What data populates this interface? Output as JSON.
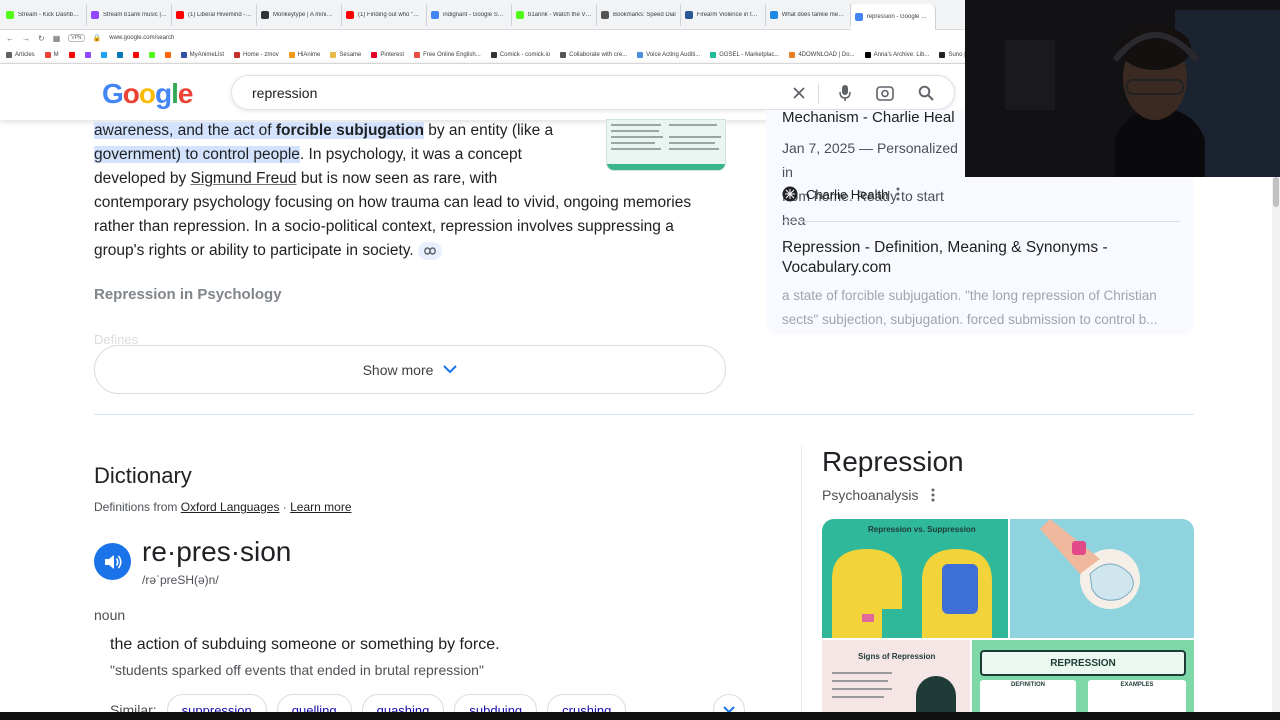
{
  "browser": {
    "tabs": [
      {
        "label": "Stream - Kick Dashboard",
        "color": "#53fc18"
      },
      {
        "label": "Stream b1ank music | Lis",
        "color": "#9146ff"
      },
      {
        "label": "(1) Liberal Hivemind - Yo",
        "color": "#ff0000"
      },
      {
        "label": "Monkeytype | A minimalis",
        "color": "#323437"
      },
      {
        "label": "(1) Finding out who \"own",
        "color": "#ff0000"
      },
      {
        "label": "indignant - Google Search",
        "color": "#4285f4"
      },
      {
        "label": "b1annk - Watch the VOD",
        "color": "#53fc18"
      },
      {
        "label": "Bookmarks: Speed Dial",
        "color": "#555555"
      },
      {
        "label": "Firearm Violence in the U",
        "color": "#2b5797"
      },
      {
        "label": "What does tankie mean -",
        "color": "#1e88e5"
      },
      {
        "label": "repression - Google Searc",
        "color": "#4285f4"
      }
    ],
    "url": "www.google.com/search",
    "vpn_label": "VPN",
    "bookmarks": [
      "Articles",
      "M",
      "",
      "",
      "",
      "",
      "",
      "",
      "",
      "MyAnimeList",
      "Home - zmov",
      "HiAnime",
      "Sesame",
      "Pinterest",
      "Free Online English...",
      "Comick - comick.io",
      "Collaborate with cre...",
      "Voice Acting Auditi...",
      "GGSEL - Marketplac...",
      "4DOWNLOAD | Do...",
      "Anna's Archive: Lib...",
      "Suno | AI Music"
    ]
  },
  "search": {
    "logo": [
      "G",
      "o",
      "o",
      "g",
      "l",
      "e"
    ],
    "query": "repression"
  },
  "snippet": {
    "line1_hl_a": "awareness, and the act of ",
    "line1_hl_b": "forcible subjugation",
    "line1_rest": " by an entity (like a",
    "line2_hl": "government) to control people",
    "line2_rest": ". In psychology, it was a concept",
    "line3_a": "developed by ",
    "line3_link": "Sigmund Freud",
    "line3_b": " but is now seen as rare, with",
    "line4": "contemporary psychology focusing on how trauma can lead to vivid, ongoing memories",
    "line5": "rather than repression. In a socio-political context, repression involves suppressing a",
    "line6": "group's rights or ability to participate in society.",
    "subheading": "Repression in Psychology",
    "faded_item": "Defines",
    "show_more": "Show more"
  },
  "right_results": {
    "title1": "Mechanism - Charlie Heal",
    "date_line1": "Jan 7, 2025 — Personalized in",
    "date_line2": "from home. Ready to start hea",
    "source_name": "Charlie Health",
    "title2": "Repression - Definition, Meaning & Synonyms - Vocabulary.com",
    "desc": "a state of forcible subjugation. \"the long repression of Christian sects\" subjection, subjugation. forced submission to control b..."
  },
  "dictionary": {
    "title": "Dictionary",
    "from_prefix": "Definitions from ",
    "from_source": "Oxford Languages",
    "sep": " · ",
    "learn_more": "Learn more",
    "word": "re·pres·sion",
    "pronunciation": "/rəˈpreSH(ə)n/",
    "part_of_speech": "noun",
    "definition": "the action of subduing someone or something by force.",
    "example": "\"students sparked off events that ended in brutal repression\"",
    "similar_label": "Similar:",
    "similar": [
      "suppression",
      "quelling",
      "quashing",
      "subduing",
      "crushing"
    ]
  },
  "knowledge_panel": {
    "title": "Repression",
    "subtitle": "Psychoanalysis",
    "image1_caption": "Repression vs. Suppression",
    "image3_caption": "Signs of Repression",
    "image4_caption": "REPRESSION",
    "image4_definition": "DEFINITION",
    "image4_examples": "EXAMPLES"
  },
  "colors": {
    "link_blue": "#1a0dab",
    "highlight": "#d3e3fd",
    "accent_blue": "#1a73e8"
  }
}
